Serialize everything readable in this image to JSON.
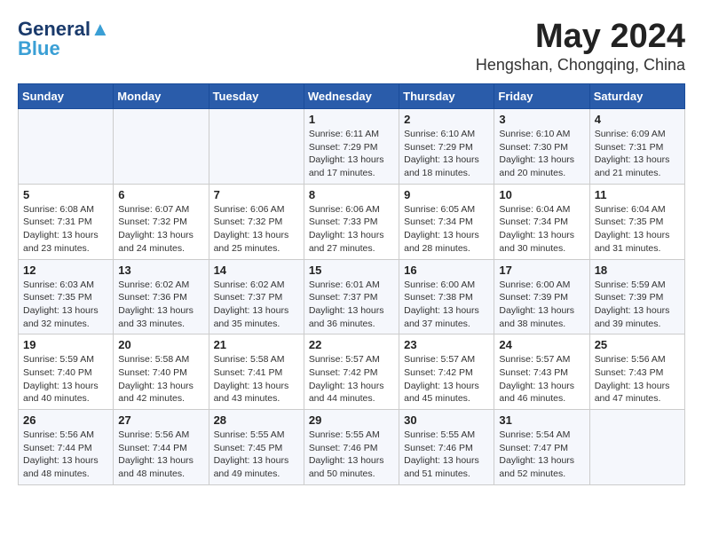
{
  "header": {
    "logo_line1": "General",
    "logo_line2": "Blue",
    "month_year": "May 2024",
    "location": "Hengshan, Chongqing, China"
  },
  "days_of_week": [
    "Sunday",
    "Monday",
    "Tuesday",
    "Wednesday",
    "Thursday",
    "Friday",
    "Saturday"
  ],
  "weeks": [
    [
      {
        "day": "",
        "info": ""
      },
      {
        "day": "",
        "info": ""
      },
      {
        "day": "",
        "info": ""
      },
      {
        "day": "1",
        "info": "Sunrise: 6:11 AM\nSunset: 7:29 PM\nDaylight: 13 hours\nand 17 minutes."
      },
      {
        "day": "2",
        "info": "Sunrise: 6:10 AM\nSunset: 7:29 PM\nDaylight: 13 hours\nand 18 minutes."
      },
      {
        "day": "3",
        "info": "Sunrise: 6:10 AM\nSunset: 7:30 PM\nDaylight: 13 hours\nand 20 minutes."
      },
      {
        "day": "4",
        "info": "Sunrise: 6:09 AM\nSunset: 7:31 PM\nDaylight: 13 hours\nand 21 minutes."
      }
    ],
    [
      {
        "day": "5",
        "info": "Sunrise: 6:08 AM\nSunset: 7:31 PM\nDaylight: 13 hours\nand 23 minutes."
      },
      {
        "day": "6",
        "info": "Sunrise: 6:07 AM\nSunset: 7:32 PM\nDaylight: 13 hours\nand 24 minutes."
      },
      {
        "day": "7",
        "info": "Sunrise: 6:06 AM\nSunset: 7:32 PM\nDaylight: 13 hours\nand 25 minutes."
      },
      {
        "day": "8",
        "info": "Sunrise: 6:06 AM\nSunset: 7:33 PM\nDaylight: 13 hours\nand 27 minutes."
      },
      {
        "day": "9",
        "info": "Sunrise: 6:05 AM\nSunset: 7:34 PM\nDaylight: 13 hours\nand 28 minutes."
      },
      {
        "day": "10",
        "info": "Sunrise: 6:04 AM\nSunset: 7:34 PM\nDaylight: 13 hours\nand 30 minutes."
      },
      {
        "day": "11",
        "info": "Sunrise: 6:04 AM\nSunset: 7:35 PM\nDaylight: 13 hours\nand 31 minutes."
      }
    ],
    [
      {
        "day": "12",
        "info": "Sunrise: 6:03 AM\nSunset: 7:35 PM\nDaylight: 13 hours\nand 32 minutes."
      },
      {
        "day": "13",
        "info": "Sunrise: 6:02 AM\nSunset: 7:36 PM\nDaylight: 13 hours\nand 33 minutes."
      },
      {
        "day": "14",
        "info": "Sunrise: 6:02 AM\nSunset: 7:37 PM\nDaylight: 13 hours\nand 35 minutes."
      },
      {
        "day": "15",
        "info": "Sunrise: 6:01 AM\nSunset: 7:37 PM\nDaylight: 13 hours\nand 36 minutes."
      },
      {
        "day": "16",
        "info": "Sunrise: 6:00 AM\nSunset: 7:38 PM\nDaylight: 13 hours\nand 37 minutes."
      },
      {
        "day": "17",
        "info": "Sunrise: 6:00 AM\nSunset: 7:39 PM\nDaylight: 13 hours\nand 38 minutes."
      },
      {
        "day": "18",
        "info": "Sunrise: 5:59 AM\nSunset: 7:39 PM\nDaylight: 13 hours\nand 39 minutes."
      }
    ],
    [
      {
        "day": "19",
        "info": "Sunrise: 5:59 AM\nSunset: 7:40 PM\nDaylight: 13 hours\nand 40 minutes."
      },
      {
        "day": "20",
        "info": "Sunrise: 5:58 AM\nSunset: 7:40 PM\nDaylight: 13 hours\nand 42 minutes."
      },
      {
        "day": "21",
        "info": "Sunrise: 5:58 AM\nSunset: 7:41 PM\nDaylight: 13 hours\nand 43 minutes."
      },
      {
        "day": "22",
        "info": "Sunrise: 5:57 AM\nSunset: 7:42 PM\nDaylight: 13 hours\nand 44 minutes."
      },
      {
        "day": "23",
        "info": "Sunrise: 5:57 AM\nSunset: 7:42 PM\nDaylight: 13 hours\nand 45 minutes."
      },
      {
        "day": "24",
        "info": "Sunrise: 5:57 AM\nSunset: 7:43 PM\nDaylight: 13 hours\nand 46 minutes."
      },
      {
        "day": "25",
        "info": "Sunrise: 5:56 AM\nSunset: 7:43 PM\nDaylight: 13 hours\nand 47 minutes."
      }
    ],
    [
      {
        "day": "26",
        "info": "Sunrise: 5:56 AM\nSunset: 7:44 PM\nDaylight: 13 hours\nand 48 minutes."
      },
      {
        "day": "27",
        "info": "Sunrise: 5:56 AM\nSunset: 7:44 PM\nDaylight: 13 hours\nand 48 minutes."
      },
      {
        "day": "28",
        "info": "Sunrise: 5:55 AM\nSunset: 7:45 PM\nDaylight: 13 hours\nand 49 minutes."
      },
      {
        "day": "29",
        "info": "Sunrise: 5:55 AM\nSunset: 7:46 PM\nDaylight: 13 hours\nand 50 minutes."
      },
      {
        "day": "30",
        "info": "Sunrise: 5:55 AM\nSunset: 7:46 PM\nDaylight: 13 hours\nand 51 minutes."
      },
      {
        "day": "31",
        "info": "Sunrise: 5:54 AM\nSunset: 7:47 PM\nDaylight: 13 hours\nand 52 minutes."
      },
      {
        "day": "",
        "info": ""
      }
    ]
  ]
}
